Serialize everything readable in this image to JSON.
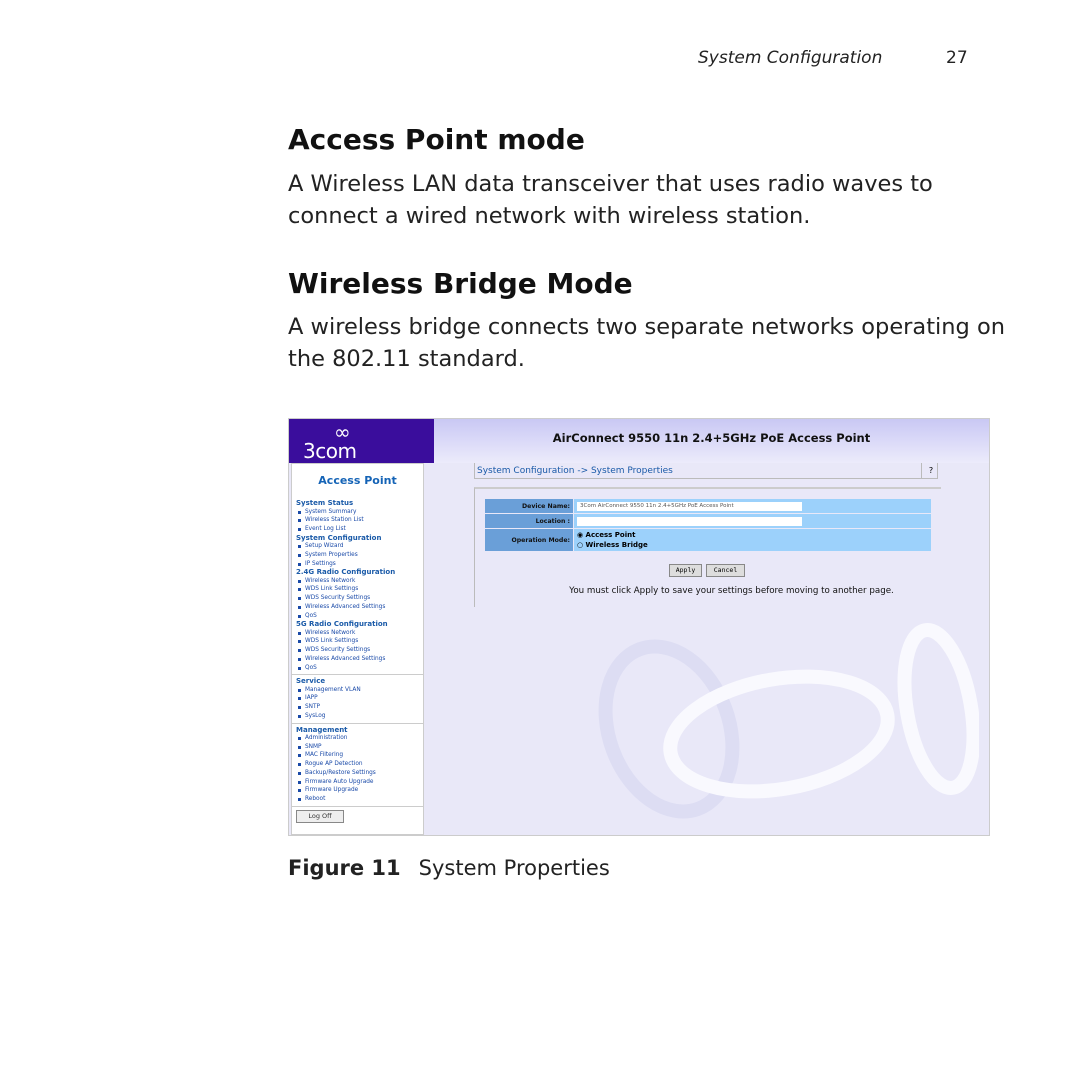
{
  "running_header": "System Configuration",
  "page_number": "27",
  "sections": [
    {
      "heading": "Access Point mode",
      "text": "A Wireless LAN data transceiver that uses radio waves to connect a wired network with wireless station."
    },
    {
      "heading": "Wireless Bridge Mode",
      "text": "A wireless bridge connects two separate networks operating on the 802.11 standard."
    }
  ],
  "screenshot": {
    "brand": "3com",
    "header_title": "AirConnect 9550 11n 2.4+5GHz PoE Access Point",
    "sidebar": {
      "title": "Access Point",
      "groups": [
        {
          "label": "System Status",
          "items": [
            "System Summary",
            "Wireless Station List",
            "Event Log List"
          ]
        },
        {
          "label": "System Configuration",
          "items": [
            "Setup Wizard",
            "System Properties",
            "IP Settings"
          ]
        },
        {
          "label": "2.4G Radio Configuration",
          "items": [
            "Wireless Network",
            "WDS Link Settings",
            "WDS Security Settings",
            "Wireless Advanced Settings",
            "QoS"
          ]
        },
        {
          "label": "5G Radio Configuration",
          "items": [
            "Wireless Network",
            "WDS Link Settings",
            "WDS Security Settings",
            "Wireless Advanced Settings",
            "QoS"
          ]
        },
        {
          "label": "Service",
          "items": [
            "Management VLAN",
            "IAPP",
            "SNTP",
            "SysLog"
          ]
        },
        {
          "label": "Management",
          "items": [
            "Administration",
            "SNMP",
            "MAC Filtering",
            "Rogue AP Detection",
            "Backup/Restore Settings",
            "Firmware Auto Upgrade",
            "Firmware Upgrade",
            "Reboot"
          ]
        }
      ],
      "logoff": "Log Off"
    },
    "breadcrumb": "System Configuration -> System Properties",
    "help": "?",
    "form": {
      "device_name_label": "Device Name:",
      "device_name_value": "3Com AirConnect 9550 11n 2.4+5GHz PoE Access Point",
      "location_label": "Location :",
      "location_value": "",
      "mode_label": "Operation Mode:",
      "mode_options": [
        "Access Point",
        "Wireless Bridge"
      ],
      "mode_selected": "Access Point"
    },
    "apply": "Apply",
    "cancel": "Cancel",
    "note": "You must click Apply to save your settings before moving to another page."
  },
  "caption": {
    "label": "Figure 11",
    "text": "System Properties"
  }
}
